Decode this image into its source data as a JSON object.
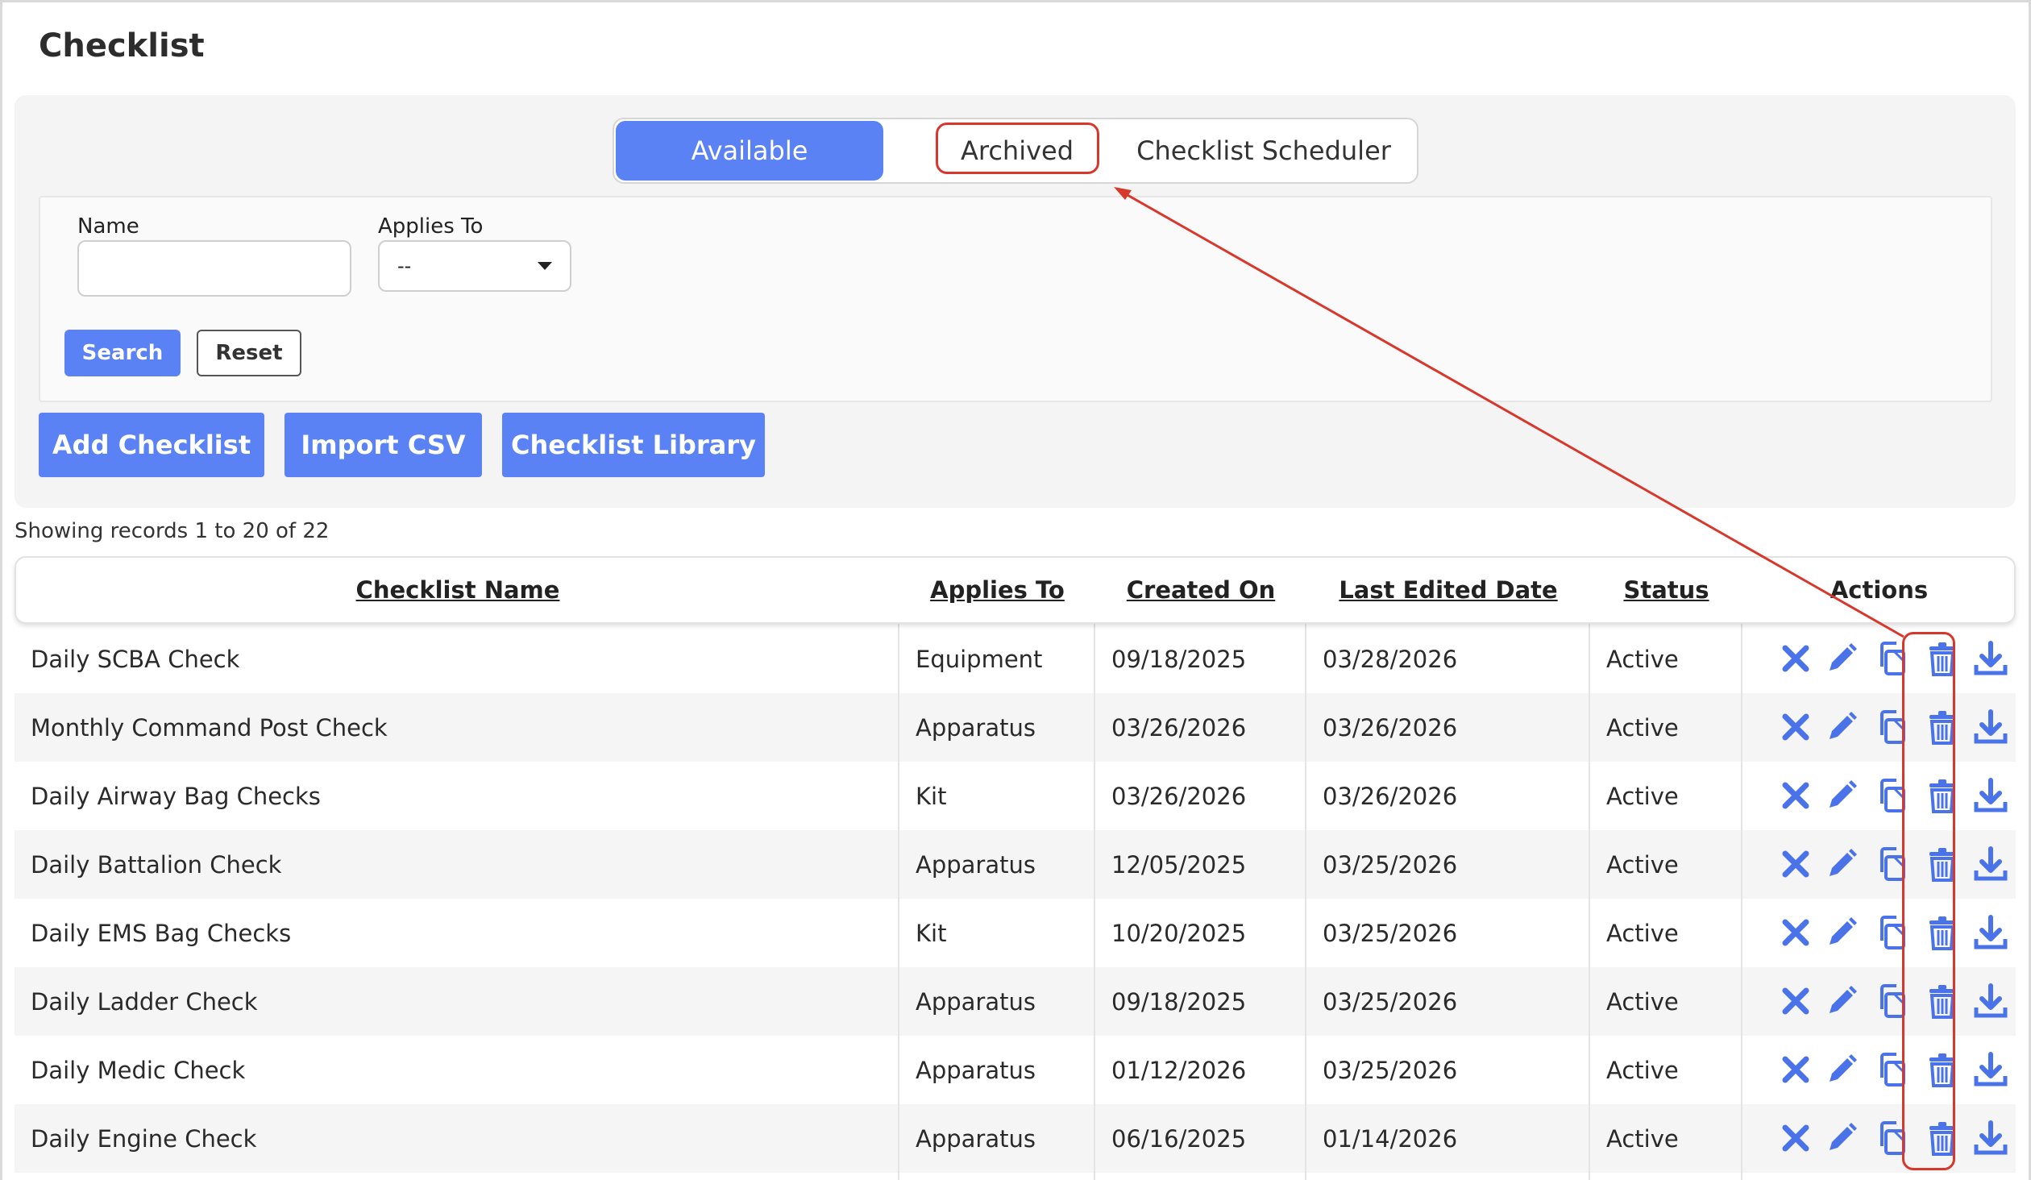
{
  "page": {
    "title": "Checklist"
  },
  "tabs": [
    {
      "label": "Available",
      "active": true
    },
    {
      "label": "Archived",
      "active": false
    },
    {
      "label": "Checklist Scheduler",
      "active": false
    }
  ],
  "filters": {
    "name_label": "Name",
    "name_value": "",
    "applies_label": "Applies To",
    "applies_value": "--",
    "search_label": "Search",
    "reset_label": "Reset"
  },
  "toolbar": {
    "add_label": "Add Checklist",
    "import_label": "Import CSV",
    "library_label": "Checklist Library"
  },
  "records_text": "Showing records 1 to 20 of 22",
  "table": {
    "headers": [
      "Checklist Name",
      "Applies To",
      "Created On",
      "Last Edited Date",
      "Status",
      "Actions"
    ],
    "rows": [
      {
        "name": "Daily SCBA Check",
        "applies": "Equipment",
        "created": "09/18/2025",
        "edited": "03/28/2026",
        "status": "Active"
      },
      {
        "name": "Monthly Command Post Check",
        "applies": "Apparatus",
        "created": "03/26/2026",
        "edited": "03/26/2026",
        "status": "Active"
      },
      {
        "name": "Daily Airway Bag Checks",
        "applies": "Kit",
        "created": "03/26/2026",
        "edited": "03/26/2026",
        "status": "Active"
      },
      {
        "name": "Daily Battalion Check",
        "applies": "Apparatus",
        "created": "12/05/2025",
        "edited": "03/25/2026",
        "status": "Active"
      },
      {
        "name": "Daily EMS Bag Checks",
        "applies": "Kit",
        "created": "10/20/2025",
        "edited": "03/25/2026",
        "status": "Active"
      },
      {
        "name": "Daily Ladder Check",
        "applies": "Apparatus",
        "created": "09/18/2025",
        "edited": "03/25/2026",
        "status": "Active"
      },
      {
        "name": "Daily Medic Check",
        "applies": "Apparatus",
        "created": "01/12/2026",
        "edited": "03/25/2026",
        "status": "Active"
      },
      {
        "name": "Daily Engine Check",
        "applies": "Apparatus",
        "created": "06/16/2025",
        "edited": "01/14/2026",
        "status": "Active"
      }
    ]
  },
  "icons": {
    "deactivate": "x-icon",
    "edit": "pencil-icon",
    "copy": "copy-icon",
    "delete": "trash-icon",
    "download": "download-icon"
  },
  "colors": {
    "accent": "#5b82f5",
    "icon": "#4a73ea",
    "annotation": "#d8382b",
    "row_alt": "#f5f5f5"
  }
}
